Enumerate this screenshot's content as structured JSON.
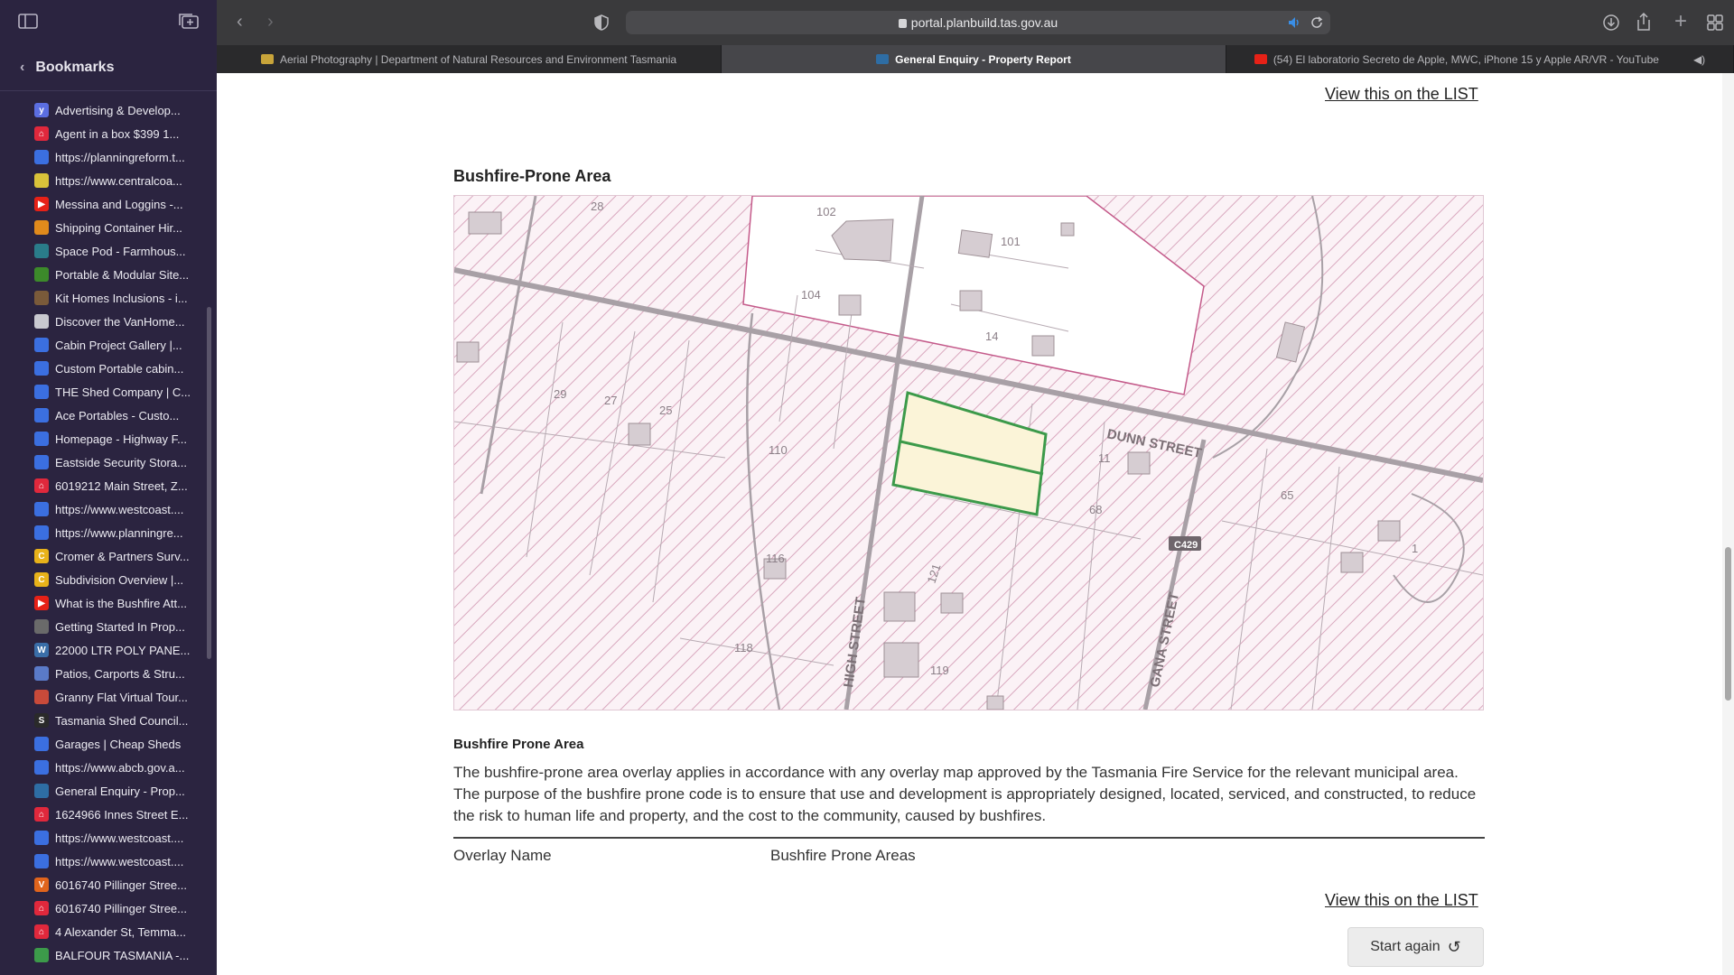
{
  "browser": {
    "url": "portal.planbuild.tas.gov.au",
    "tabs": [
      {
        "title": "Aerial Photography | Department of Natural Resources and Environment Tasmania",
        "color": "#c8a43a"
      },
      {
        "title": "General Enquiry - Property Report",
        "color": "#2e6da4",
        "active": true
      },
      {
        "title": "(54) El laboratorio Secreto de Apple, MWC, iPhone 15 y Apple AR/VR - YouTube",
        "color": "#e62117"
      }
    ]
  },
  "sidebar": {
    "title": "Bookmarks",
    "items": [
      {
        "label": "Advertising & Develop...",
        "color": "#5b6ee1",
        "glyph": "y"
      },
      {
        "label": "Agent in a box  $399  1...",
        "color": "#e0283c",
        "glyph": "⌂"
      },
      {
        "label": "https://planningreform.t...",
        "color": "#3b6fe0",
        "glyph": ""
      },
      {
        "label": "https://www.centralcoa...",
        "color": "#d9c23a",
        "glyph": ""
      },
      {
        "label": "Messina and Loggins -...",
        "color": "#e62117",
        "glyph": "▶"
      },
      {
        "label": "Shipping Container Hir...",
        "color": "#e08a1c",
        "glyph": ""
      },
      {
        "label": "Space Pod - Farmhous...",
        "color": "#2a7c8a",
        "glyph": ""
      },
      {
        "label": "Portable & Modular Site...",
        "color": "#3c8a2a",
        "glyph": ""
      },
      {
        "label": "Kit Homes Inclusions - i...",
        "color": "#7a5a3a",
        "glyph": ""
      },
      {
        "label": "Discover the VanHome...",
        "color": "#c9c9d0",
        "glyph": ""
      },
      {
        "label": "Cabin Project Gallery |...",
        "color": "#3b6fe0",
        "glyph": ""
      },
      {
        "label": "Custom Portable cabin...",
        "color": "#3b6fe0",
        "glyph": ""
      },
      {
        "label": "THE Shed Company | C...",
        "color": "#3b6fe0",
        "glyph": ""
      },
      {
        "label": "Ace Portables - Custo...",
        "color": "#3b6fe0",
        "glyph": ""
      },
      {
        "label": "Homepage - Highway F...",
        "color": "#3b6fe0",
        "glyph": ""
      },
      {
        "label": "Eastside Security Stora...",
        "color": "#3b6fe0",
        "glyph": ""
      },
      {
        "label": "6019212 Main Street, Z...",
        "color": "#e0283c",
        "glyph": "⌂"
      },
      {
        "label": "https://www.westcoast....",
        "color": "#3b6fe0",
        "glyph": ""
      },
      {
        "label": "https://www.planningre...",
        "color": "#3b6fe0",
        "glyph": ""
      },
      {
        "label": "Cromer & Partners Surv...",
        "color": "#e8b21a",
        "glyph": "C"
      },
      {
        "label": "Subdivision Overview |...",
        "color": "#e8b21a",
        "glyph": "C"
      },
      {
        "label": "What is the Bushfire Att...",
        "color": "#e62117",
        "glyph": "▶"
      },
      {
        "label": "Getting Started In Prop...",
        "color": "#6a6a6a",
        "glyph": ""
      },
      {
        "label": "22000 LTR POLY PANE...",
        "color": "#3a6ea8",
        "glyph": "W"
      },
      {
        "label": "Patios, Carports & Stru...",
        "color": "#5a7ac8",
        "glyph": ""
      },
      {
        "label": "Granny Flat Virtual Tour...",
        "color": "#c84a3a",
        "glyph": ""
      },
      {
        "label": "Tasmania Shed Council...",
        "color": "#2a2a2a",
        "glyph": "S"
      },
      {
        "label": "Garages | Cheap Sheds",
        "color": "#3b6fe0",
        "glyph": ""
      },
      {
        "label": "https://www.abcb.gov.a...",
        "color": "#3b6fe0",
        "glyph": ""
      },
      {
        "label": "General Enquiry - Prop...",
        "color": "#2e6da4",
        "glyph": ""
      },
      {
        "label": "1624966 Innes Street E...",
        "color": "#e0283c",
        "glyph": "⌂"
      },
      {
        "label": "https://www.westcoast....",
        "color": "#3b6fe0",
        "glyph": ""
      },
      {
        "label": "https://www.westcoast....",
        "color": "#3b6fe0",
        "glyph": ""
      },
      {
        "label": "6016740 Pillinger Stree...",
        "color": "#e0641c",
        "glyph": "V"
      },
      {
        "label": "6016740 Pillinger Stree...",
        "color": "#e0283c",
        "glyph": "⌂"
      },
      {
        "label": "4 Alexander St, Temma...",
        "color": "#e0283c",
        "glyph": "⌂"
      },
      {
        "label": "BALFOUR TASMANIA -...",
        "color": "#3c9a4a",
        "glyph": ""
      }
    ]
  },
  "page": {
    "link_label": "View this on the LIST",
    "section_title": "Bushfire-Prone Area",
    "map_labels": {
      "street_dunn": "DUNN STREET",
      "street_high": "HIGH STREET",
      "street_gana": "GANA STREET",
      "road_code": "C429",
      "lots": [
        "102",
        "101",
        "104",
        "14",
        "29",
        "27",
        "25",
        "110",
        "11",
        "65",
        "68",
        "116",
        "118",
        "119",
        "1",
        "28",
        "121"
      ]
    },
    "subsection_title": "Bushfire Prone Area",
    "description": "The bushfire-prone area overlay applies in accordance with any overlay map approved by the Tasmania Fire Service for the relevant municipal area. The purpose of the bushfire prone code is to ensure that use and development is appropriately designed, located, serviced, and constructed, to reduce the risk to human life and property, and the cost to the community, caused by bushfires.",
    "overlay_name_label": "Overlay Name",
    "overlay_name_value": "Bushfire Prone Areas",
    "start_again_label": "Start again"
  }
}
